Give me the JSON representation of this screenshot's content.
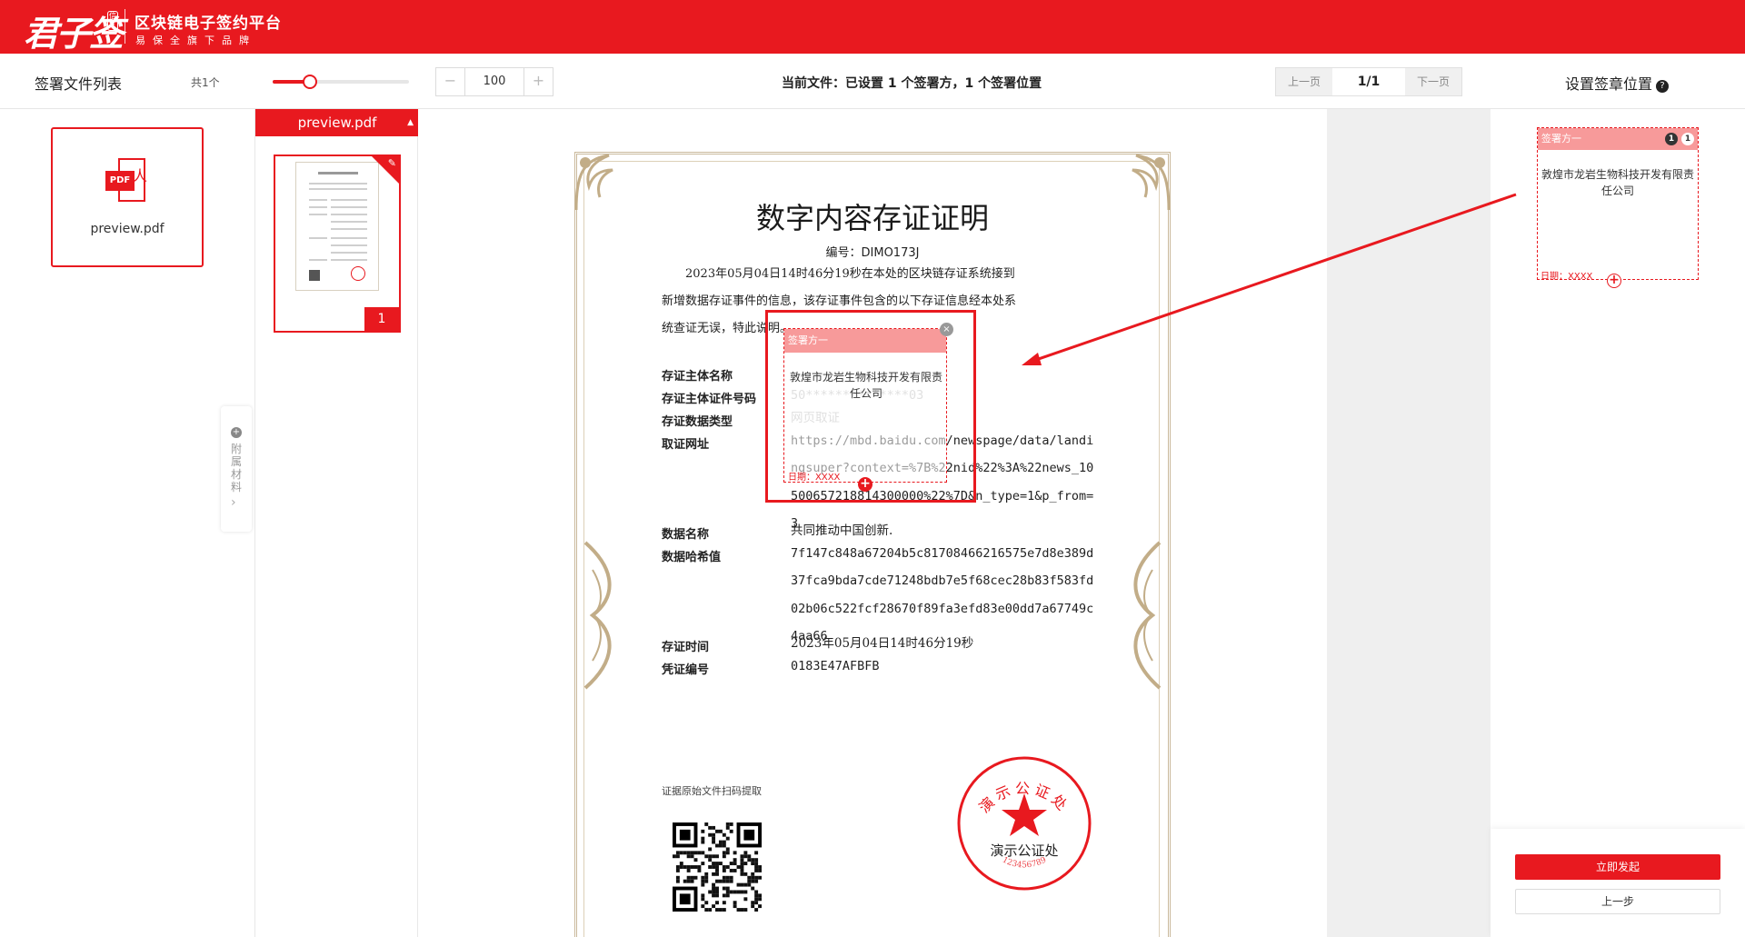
{
  "header": {
    "logo_text": "君子签",
    "logo_seal": "信",
    "slogan": "区块链电子签约平台",
    "subtitle": "易保全旗下品牌"
  },
  "file_list": {
    "title": "签署文件列表",
    "count": "共1个",
    "files": [
      {
        "name": "preview.pdf",
        "icon": "pdf-icon",
        "badge": "PDF"
      }
    ]
  },
  "toolbar": {
    "zoom_slider_level": 0.27,
    "zoom_minus": "−",
    "zoom_value": "100",
    "zoom_plus": "+",
    "current_file": "当前文件：已设置 1 个签署方，1 个签署位置",
    "prev_page": "上一页",
    "page_indicator": "1/1",
    "next_page": "下一页"
  },
  "thumbnails": {
    "file_name": "preview.pdf",
    "caret": "▲",
    "pen_icon": "✎",
    "page_number": "1"
  },
  "attachments": {
    "plus": "+",
    "label": "附属材料",
    "arrow": "›"
  },
  "document": {
    "title": "数字内容存证证明",
    "number": "编号：DIMO173J",
    "intro_line1": "2023年05月04日14时46分19秒在本处的区块链存证系统接到",
    "intro_line2": "新增数据存证事件的信息，该存证事件包含的以下存证信息经本处系",
    "intro_line3": "统查证无误，特此说明。",
    "fields": [
      {
        "label": "存证主体名称",
        "value": ""
      },
      {
        "label": "存证主体证件号码",
        "value": "50**************03"
      },
      {
        "label": "存证数据类型",
        "value": "网页取证"
      },
      {
        "label": "取证网址",
        "value": "https://mbd.baidu.com/newspage/data/landingsuper?context=%7B%22nid%22%3A%22news_10500657218814300000%22%7D&n_type=1&p_from=3"
      },
      {
        "label": "数据名称",
        "value": "共同推动中国创新."
      },
      {
        "label": "数据哈希值",
        "value": "7f147c848a67204b5c81708466216575e7d8e389d37fca9bda7cde71248bdb7e5f68cec28b83f583fd02b06c522fcf28670f89fa3efd83e00dd7a67749c4aa66"
      },
      {
        "label": "存证时间",
        "value": "2023年05月04日14时46分19秒"
      },
      {
        "label": "凭证编号",
        "value": "0183E47AFBFB"
      }
    ],
    "qr_label": "证据原始文件扫码提取",
    "stamp_top": "演示公证处",
    "stamp_center": "演示公证处",
    "stamp_number": "123456789"
  },
  "placed_signature": {
    "header": "签署方一",
    "close": "×",
    "company": "敦煌市龙岩生物科技开发有限责任公司",
    "date": "日期：XXXX",
    "plus": "+"
  },
  "right_panel": {
    "title": "设置签章位置",
    "help": "?",
    "signer": {
      "header": "签署方一",
      "badge_count": "1",
      "badge_index": "1",
      "company": "敦煌市龙岩生物科技开发有限责任公司",
      "date": "日期：XXXX",
      "plus": "+"
    },
    "submit": "立即发起",
    "back": "上一步"
  },
  "colors": {
    "brand": "#e8191f",
    "signer_header": "#f79a9a",
    "doc_border": "#c9b89a"
  }
}
